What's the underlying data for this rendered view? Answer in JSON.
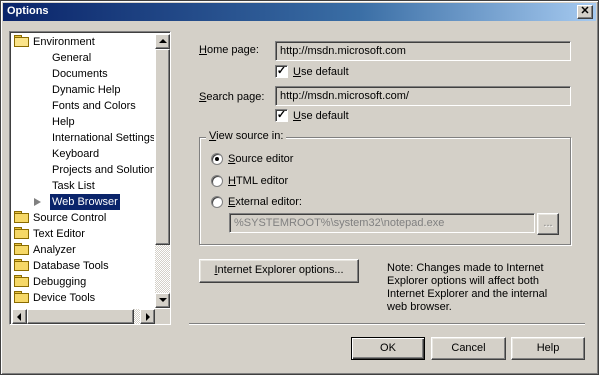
{
  "window": {
    "title": "Options",
    "close_glyph": "✕"
  },
  "tree": {
    "items": [
      {
        "label": "Environment",
        "icon": "folder-open-icon"
      },
      {
        "label": "General"
      },
      {
        "label": "Documents"
      },
      {
        "label": "Dynamic Help"
      },
      {
        "label": "Fonts and Colors"
      },
      {
        "label": "Help"
      },
      {
        "label": "International Settings"
      },
      {
        "label": "Keyboard"
      },
      {
        "label": "Projects and Solutions"
      },
      {
        "label": "Task List"
      },
      {
        "label": "Web Browser",
        "selected": true
      },
      {
        "label": "Source Control",
        "icon": "folder-icon"
      },
      {
        "label": "Text Editor",
        "icon": "folder-icon"
      },
      {
        "label": "Analyzer",
        "icon": "folder-icon"
      },
      {
        "label": "Database Tools",
        "icon": "folder-icon"
      },
      {
        "label": "Debugging",
        "icon": "folder-icon"
      },
      {
        "label": "Device Tools",
        "icon": "folder-icon"
      }
    ]
  },
  "home_page": {
    "label_prefix": "",
    "label_underline": "H",
    "label_rest": "ome page:",
    "value": "http://msdn.microsoft.com",
    "use_default_underline": "U",
    "use_default_rest": "se default",
    "use_default_checked": true
  },
  "search_page": {
    "label_prefix": "",
    "label_underline": "S",
    "label_rest": "earch page:",
    "value": "http://msdn.microsoft.com/",
    "use_default_underline": "U",
    "use_default_rest": "se default",
    "use_default_checked": true
  },
  "view_source": {
    "title_underline": "V",
    "title_rest": "iew source in:",
    "options": [
      {
        "underline": "S",
        "rest": "ource editor",
        "checked": true
      },
      {
        "underline": "H",
        "rest": "TML editor",
        "checked": false
      },
      {
        "underline": "E",
        "rest": "xternal editor:",
        "checked": false
      }
    ],
    "external_path": "%SYSTEMROOT%\\system32\\notepad.exe",
    "browse_label": "..."
  },
  "ie_options": {
    "underline": "I",
    "rest": "nternet Explorer options..."
  },
  "note": {
    "lines": [
      "Note: Changes made to Internet",
      "Explorer options will affect both",
      "Internet Explorer and the internal",
      "web browser."
    ]
  },
  "buttons": {
    "ok": "OK",
    "cancel": "Cancel",
    "help": "Help"
  }
}
